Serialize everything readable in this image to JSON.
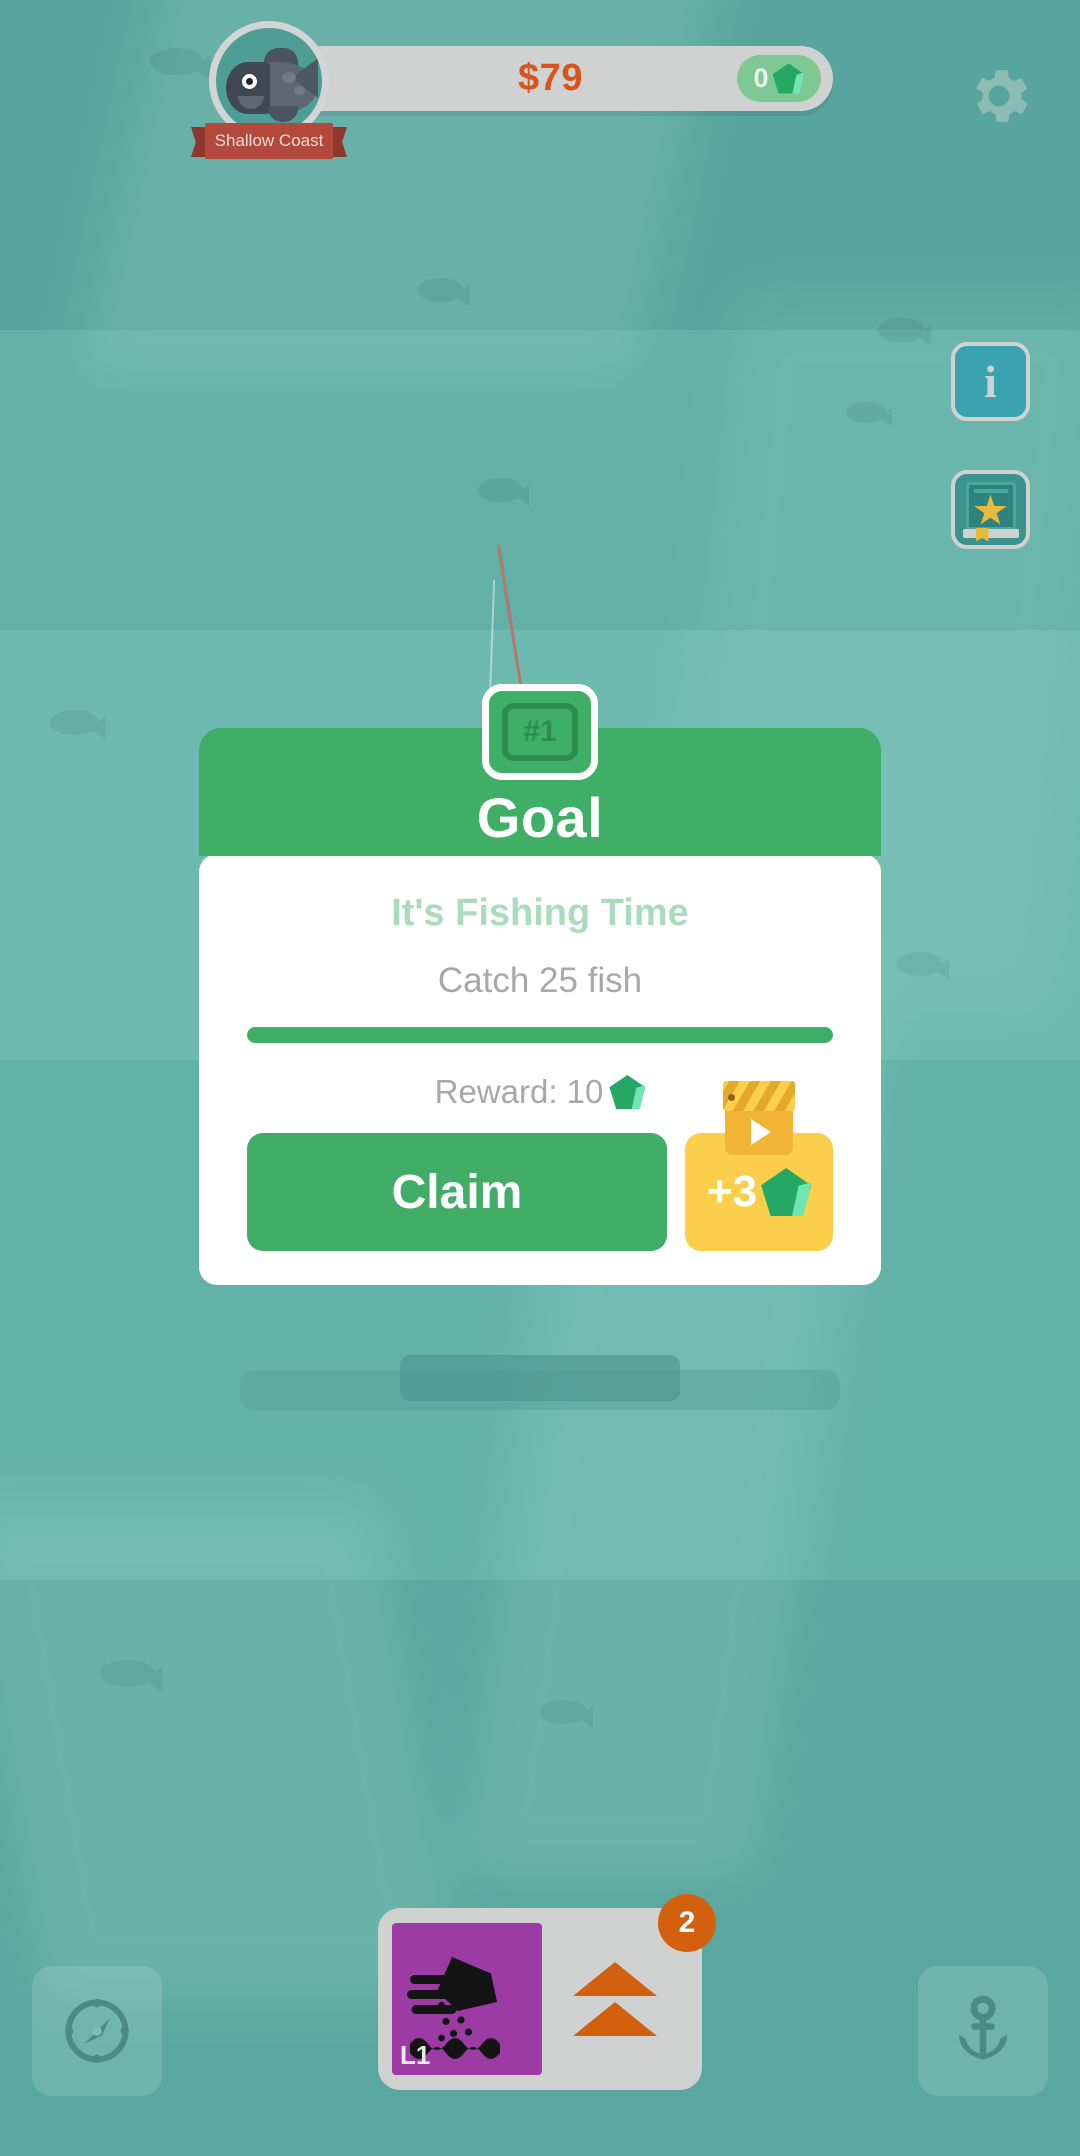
{
  "header": {
    "money": "$79",
    "gems": "0",
    "location_banner": "Shallow Coast",
    "avatar_icon": "fish-avatar-icon",
    "gem_icon": "gem-icon",
    "settings_icon": "gear-icon"
  },
  "side_buttons": [
    {
      "name": "info",
      "icon": "info-icon",
      "label": "i"
    },
    {
      "name": "collection",
      "icon": "book-star-icon",
      "label": ""
    }
  ],
  "goal_dialog": {
    "badge": "#1",
    "title": "Goal",
    "quest_name": "It's Fishing Time",
    "quest_desc": "Catch 25 fish",
    "progress_percent": 100,
    "reward_label": "Reward: 10",
    "reward_gem_icon": "gem-icon",
    "claim_label": "Claim",
    "ad_label": "+3",
    "ad_icon": "clapperboard-play-icon"
  },
  "bottom_bar": {
    "map_button_icon": "compass-icon",
    "anchor_button_icon": "anchor-icon",
    "tackle": {
      "bait_icon": "hand-bait-over-water-icon",
      "bait_level": "L1",
      "upgrade_icon": "double-chevron-up-icon",
      "badge_count": "2"
    }
  },
  "colors": {
    "water": "#5aa79e",
    "accent_green": "#3fae66",
    "money_orange": "#d8551a",
    "ad_yellow": "#fbcf4b",
    "badge_orange": "#d2600f",
    "bait_purple": "#9c3ba4",
    "gem_green": "#24a863"
  }
}
